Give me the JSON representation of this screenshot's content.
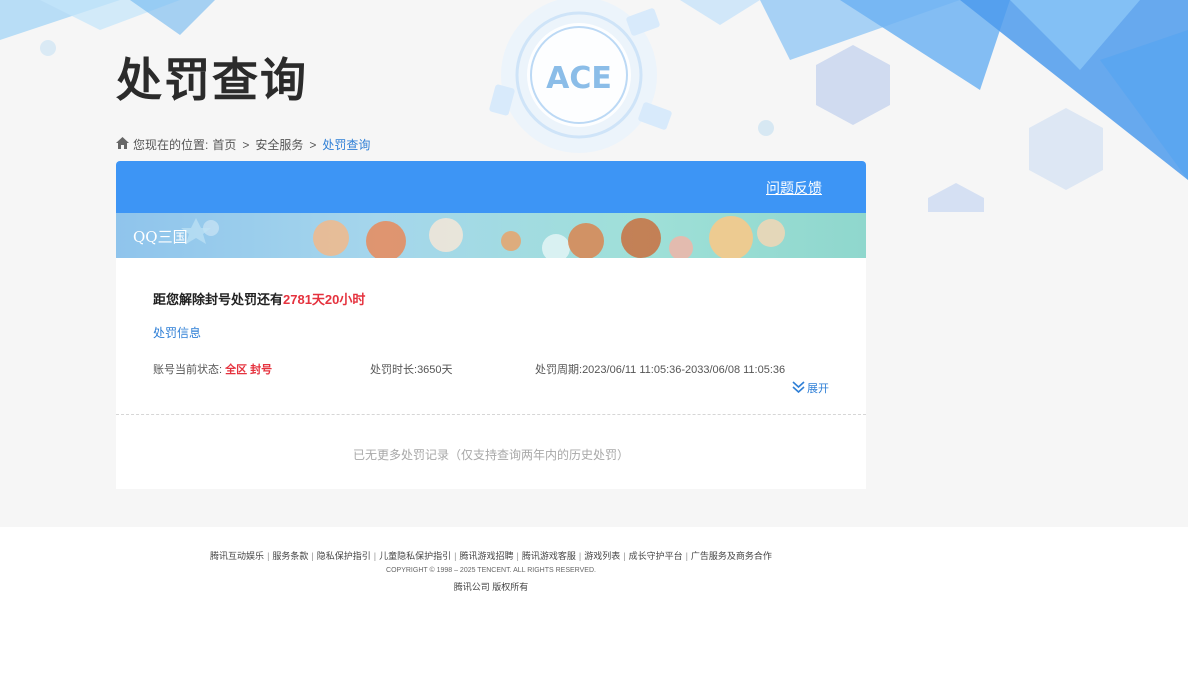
{
  "page": {
    "title": "处罚查询",
    "logo_text": "ACE"
  },
  "breadcrumb": {
    "prefix": "您现在的位置:",
    "items": [
      "首页",
      "安全服务",
      "处罚查询"
    ],
    "separator": ">"
  },
  "panel": {
    "feedback_link": "问题反馈",
    "game_name": "QQ三国",
    "countdown_prefix": "距您解除封号处罚还有",
    "countdown_value": "2781天20小时",
    "info_link": "处罚信息",
    "status_label": "账号当前状态:",
    "status_value": "全区 封号",
    "duration_label": "处罚时长:",
    "duration_value": "3650天",
    "period_label": "处罚周期:",
    "period_value": "2023/06/11 11:05:36-2033/06/08 11:05:36",
    "expand_label": "展开",
    "no_more_text": "已无更多处罚记录（仅支持查询两年内的历史处罚）"
  },
  "footer": {
    "links": [
      "腾讯互动娱乐",
      "服务条款",
      "隐私保护指引",
      "儿童隐私保护指引",
      "腾讯游戏招聘",
      "腾讯游戏客服",
      "游戏列表",
      "成长守护平台",
      "广告服务及商务合作"
    ],
    "copyright": "COPYRIGHT © 1998 – 2025 TENCENT. ALL RIGHTS RESERVED.",
    "company": "腾讯公司 版权所有"
  },
  "colors": {
    "accent_blue": "#3d95f5",
    "link_blue": "#2f7fd6",
    "alert_red": "#e5323e",
    "background": "#f6f6f6"
  },
  "icons": {
    "home": "home-icon",
    "expand": "double-chevron-down-icon"
  }
}
